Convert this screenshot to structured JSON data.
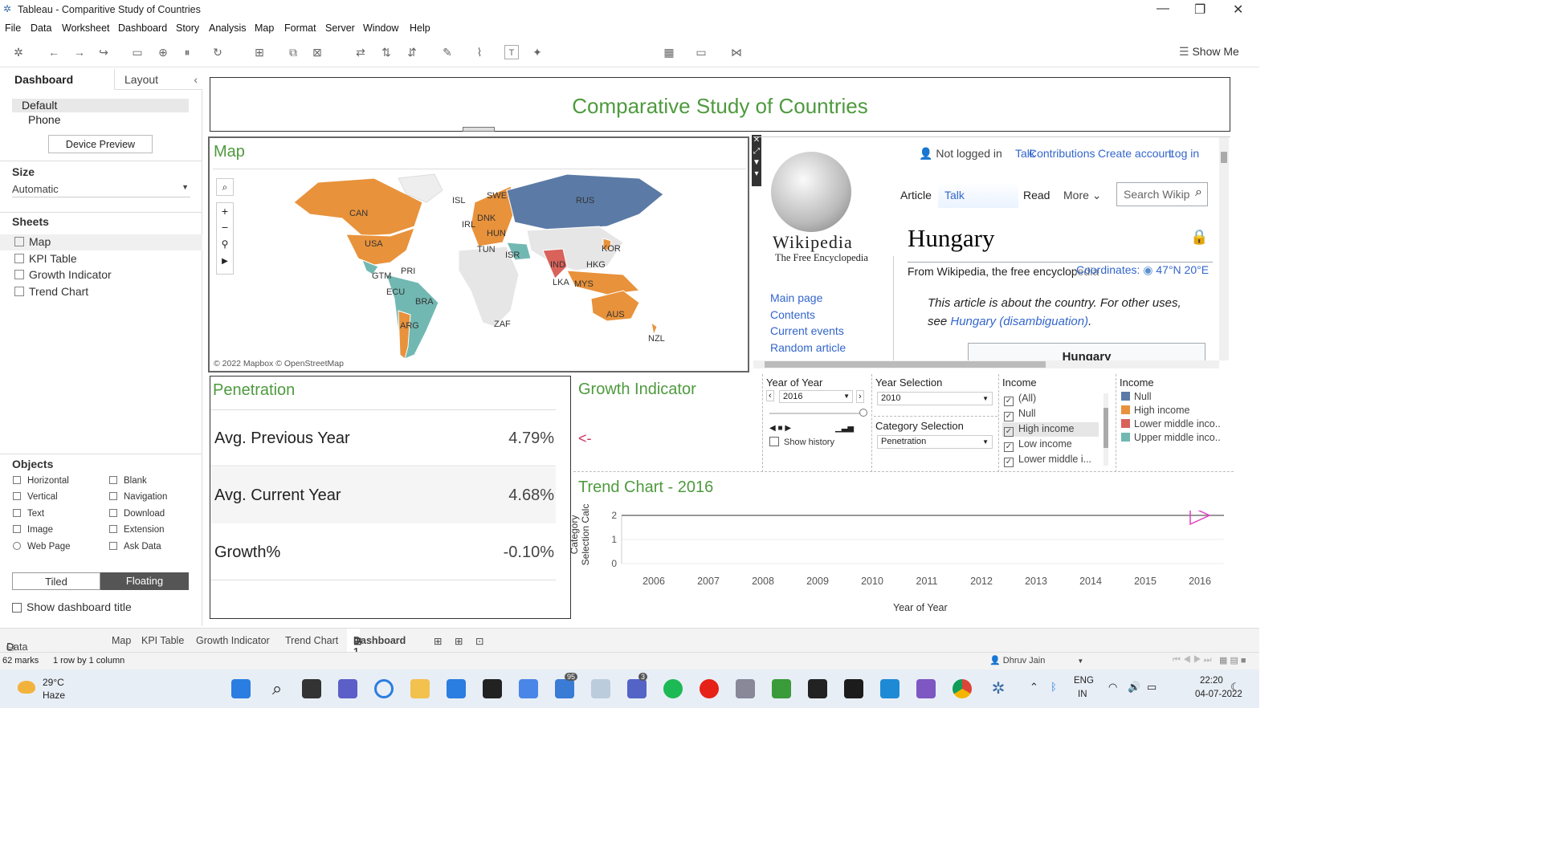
{
  "window": {
    "title": "Tableau - Comparitive Study of Countries"
  },
  "menu": [
    "File",
    "Data",
    "Worksheet",
    "Dashboard",
    "Story",
    "Analysis",
    "Map",
    "Format",
    "Server",
    "Window",
    "Help"
  ],
  "toolbar": {
    "show_me": "Show Me"
  },
  "left": {
    "tab_dashboard": "Dashboard",
    "tab_layout": "Layout",
    "device_default": "Default",
    "device_phone": "Phone",
    "device_preview": "Device Preview",
    "size_label": "Size",
    "size_value": "Automatic",
    "sheets_label": "Sheets",
    "sheets": [
      "Map",
      "KPI Table",
      "Growth Indicator",
      "Trend Chart"
    ],
    "objects_label": "Objects",
    "objects_left": [
      "Horizontal",
      "Vertical",
      "Text",
      "Image",
      "Web Page"
    ],
    "objects_right": [
      "Blank",
      "Navigation",
      "Download",
      "Extension",
      "Ask Data"
    ],
    "tiled": "Tiled",
    "floating": "Floating",
    "show_title": "Show dashboard title"
  },
  "dashboard": {
    "title": "Comparative Study of Countries",
    "map_title": "Map",
    "map_credit": "© 2022 Mapbox © OpenStreetMap",
    "map_labels": [
      "CAN",
      "USA",
      "GTM",
      "PRI",
      "ECU",
      "BRA",
      "ARG",
      "ISL",
      "SWE",
      "DNK",
      "IRL",
      "HUN",
      "TUN",
      "ISR",
      "RUS",
      "KOR",
      "IND",
      "HKG",
      "LKA",
      "MYS",
      "ZAF",
      "AUS",
      "NZL"
    ],
    "wiki": {
      "nav_user": "Not logged in",
      "nav_links": [
        "Talk",
        "Contributions",
        "Create account",
        "Log in"
      ],
      "tab_article": "Article",
      "tab_talk": "Talk",
      "tab_read": "Read",
      "tab_more": "More",
      "search_placeholder": "Search Wikip",
      "wordmark": "Wikipedia",
      "tagline": "The Free Encyclopedia",
      "side_links": [
        "Main page",
        "Contents",
        "Current events",
        "Random article"
      ],
      "heading": "Hungary",
      "from": "From Wikipedia, the free encyclopedia",
      "coords_label": "Coordinates:",
      "coords_value": "47°N 20°E",
      "hatnote_pre": "This article is about the country. For other uses, see",
      "hatnote_link": "Hungary (disambiguation)",
      "infobox_title": "Hungary"
    },
    "kpi": {
      "title": "Penetration",
      "rows": [
        {
          "label": "Avg. Previous Year",
          "value": "4.79%"
        },
        {
          "label": "Avg. Current Year",
          "value": "4.68%"
        },
        {
          "label": "Growth%",
          "value": "-0.10%"
        }
      ]
    },
    "growth": {
      "title": "Growth Indicator",
      "arrow": "<-"
    },
    "filters": {
      "year_of_year_label": "Year of Year",
      "year_of_year_value": "2016",
      "show_history": "Show history",
      "year_selection_label": "Year Selection",
      "year_selection_value": "2010",
      "category_label": "Category Selection",
      "category_value": "Penetration",
      "income_label": "Income",
      "income_items": [
        "(All)",
        "Null",
        "High income",
        "Low income",
        "Lower middle i..."
      ],
      "legend_label": "Income",
      "legend_items": [
        {
          "name": "Null",
          "color": "#5b7aa6"
        },
        {
          "name": "High income",
          "color": "#e8923b"
        },
        {
          "name": "Lower middle inco..",
          "color": "#d9625a"
        },
        {
          "name": "Upper middle inco..",
          "color": "#72b8b2"
        }
      ]
    },
    "trend": {
      "title": "Trend Chart - 2016"
    }
  },
  "chart_data": {
    "type": "line",
    "title": "Trend Chart - 2016",
    "xlabel": "Year of Year",
    "ylabel": "Category Selection Calc",
    "x": [
      2006,
      2007,
      2008,
      2009,
      2010,
      2011,
      2012,
      2013,
      2014,
      2015,
      2016
    ],
    "series": [
      {
        "values": [
          2,
          2,
          2,
          2,
          2,
          2,
          2,
          2,
          2,
          2,
          2
        ]
      }
    ],
    "ylim": [
      0,
      2
    ],
    "yticks": [
      0,
      1,
      2
    ]
  },
  "tabs": {
    "data_source": "Data Source",
    "sheets": [
      "Map",
      "KPI Table",
      "Growth Indicator",
      "Trend Chart"
    ],
    "active": "Dashboard 1"
  },
  "status": {
    "marks": "62 marks",
    "layout": "1 row by 1 column",
    "user": "Dhruv Jain"
  },
  "taskbar": {
    "temp": "29°C",
    "weather": "Haze",
    "lang1": "ENG",
    "lang2": "IN",
    "time": "22:20",
    "date": "04-07-2022",
    "badge1": "95",
    "badge2": "3"
  }
}
